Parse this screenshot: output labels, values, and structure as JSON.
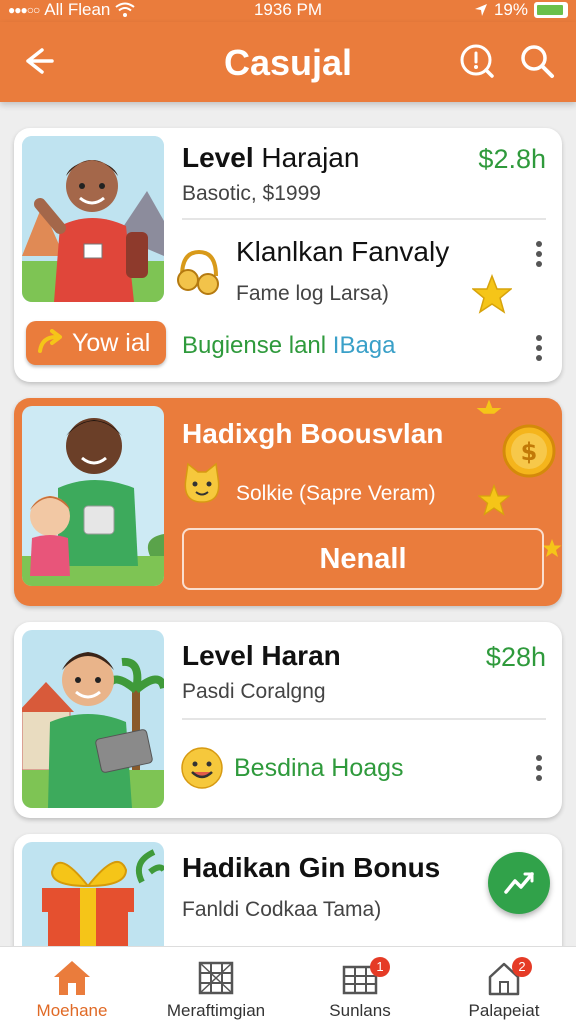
{
  "status_bar": {
    "carrier": "All Flean",
    "time": "1936 PM",
    "battery": "19%"
  },
  "header": {
    "title": "Casujal"
  },
  "cards": [
    {
      "title_bold": "Level",
      "title_rest": " Harajan",
      "subtitle": "Basotic, $1999",
      "price": "$2.8h",
      "row_title": "Klanlkan Fanvaly",
      "row_sub": "Fame log Larsa)",
      "button_label": "Yow ial",
      "link_green": "Bugiense lanl ",
      "link_blue": "IBaga"
    },
    {
      "title": "Hadixgh Boousvlan",
      "row_text": "Solkie (Sapre Veram)",
      "button_label": "Nenall"
    },
    {
      "title": "Level Haran",
      "subtitle": "Pasdi Coralgng",
      "price": "$28h",
      "row_label": "Besdina Hoags"
    },
    {
      "title": "Hadikan Gin Bonus",
      "subtitle": "Fanldi Codkaa Tama)"
    }
  ],
  "tabs": [
    {
      "label": "Moehane",
      "active": true
    },
    {
      "label": "Meraftimgian",
      "active": false
    },
    {
      "label": "Sunlans",
      "badge": "1",
      "active": false
    },
    {
      "label": "Palapeiat",
      "badge": "2",
      "active": false
    }
  ],
  "colors": {
    "brand": "#ea7c3c",
    "price_green": "#2f9a3c",
    "link_blue": "#3aa0c8"
  }
}
